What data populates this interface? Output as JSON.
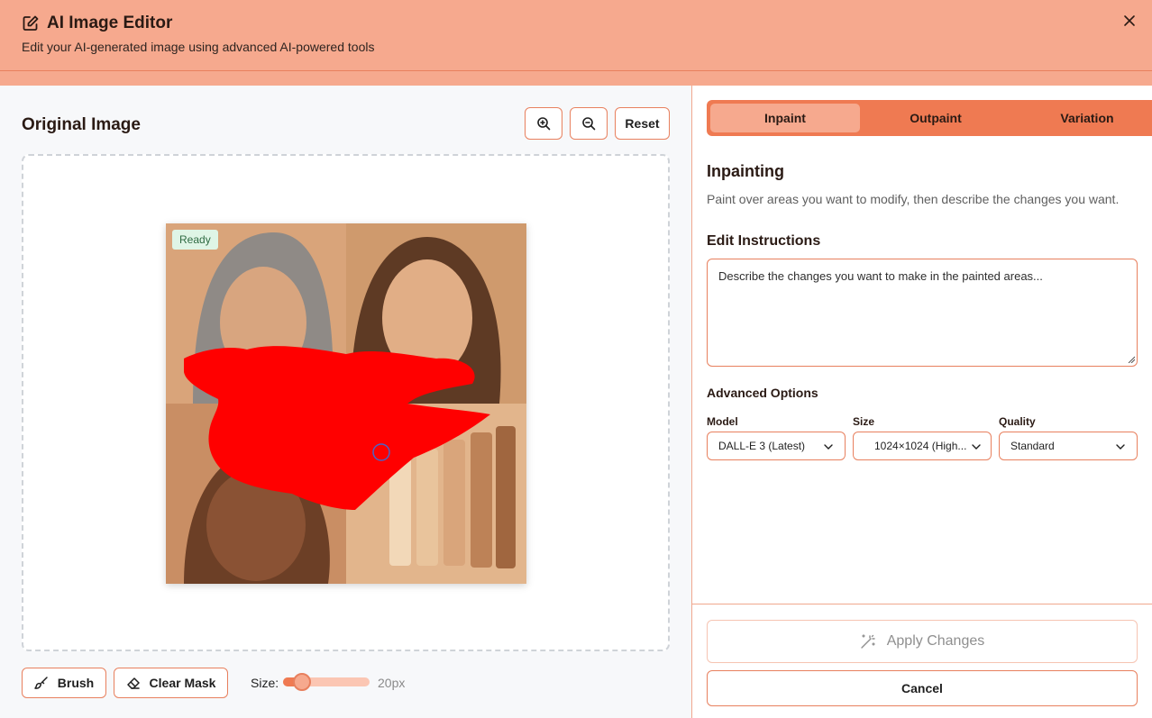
{
  "header": {
    "title": "AI Image Editor",
    "subtitle": "Edit your AI-generated image using advanced AI-powered tools",
    "icon": "edit-icon",
    "close_icon": "close-icon"
  },
  "editor": {
    "title": "Original Image",
    "zoom_in_icon": "zoom-in-icon",
    "zoom_out_icon": "zoom-out-icon",
    "reset_label": "Reset",
    "image_status": "Ready",
    "brush_label": "Brush",
    "clear_mask_label": "Clear Mask",
    "size_label": "Size:",
    "size_value": "20px",
    "size_slider_fraction": 0.22
  },
  "tabs": [
    {
      "label": "Inpaint",
      "active": true
    },
    {
      "label": "Outpaint",
      "active": false
    },
    {
      "label": "Variation",
      "active": false
    }
  ],
  "panel": {
    "section_title": "Inpainting",
    "section_desc": "Paint over areas you want to modify, then describe the changes you want.",
    "instructions_label": "Edit Instructions",
    "instructions_placeholder": "Describe the changes you want to make in the painted areas...",
    "advanced_label": "Advanced Options",
    "model": {
      "label": "Model",
      "value": "DALL-E 3 (Latest)"
    },
    "size": {
      "label": "Size",
      "value": "1024×1024 (High..."
    },
    "quality": {
      "label": "Quality",
      "value": "Standard"
    }
  },
  "actions": {
    "apply_label": "Apply Changes",
    "apply_icon": "magic-wand-icon",
    "cancel_label": "Cancel"
  },
  "colors": {
    "accent": "#ef7a52",
    "accent_light": "#f6a98e",
    "mask": "#ff0000"
  }
}
